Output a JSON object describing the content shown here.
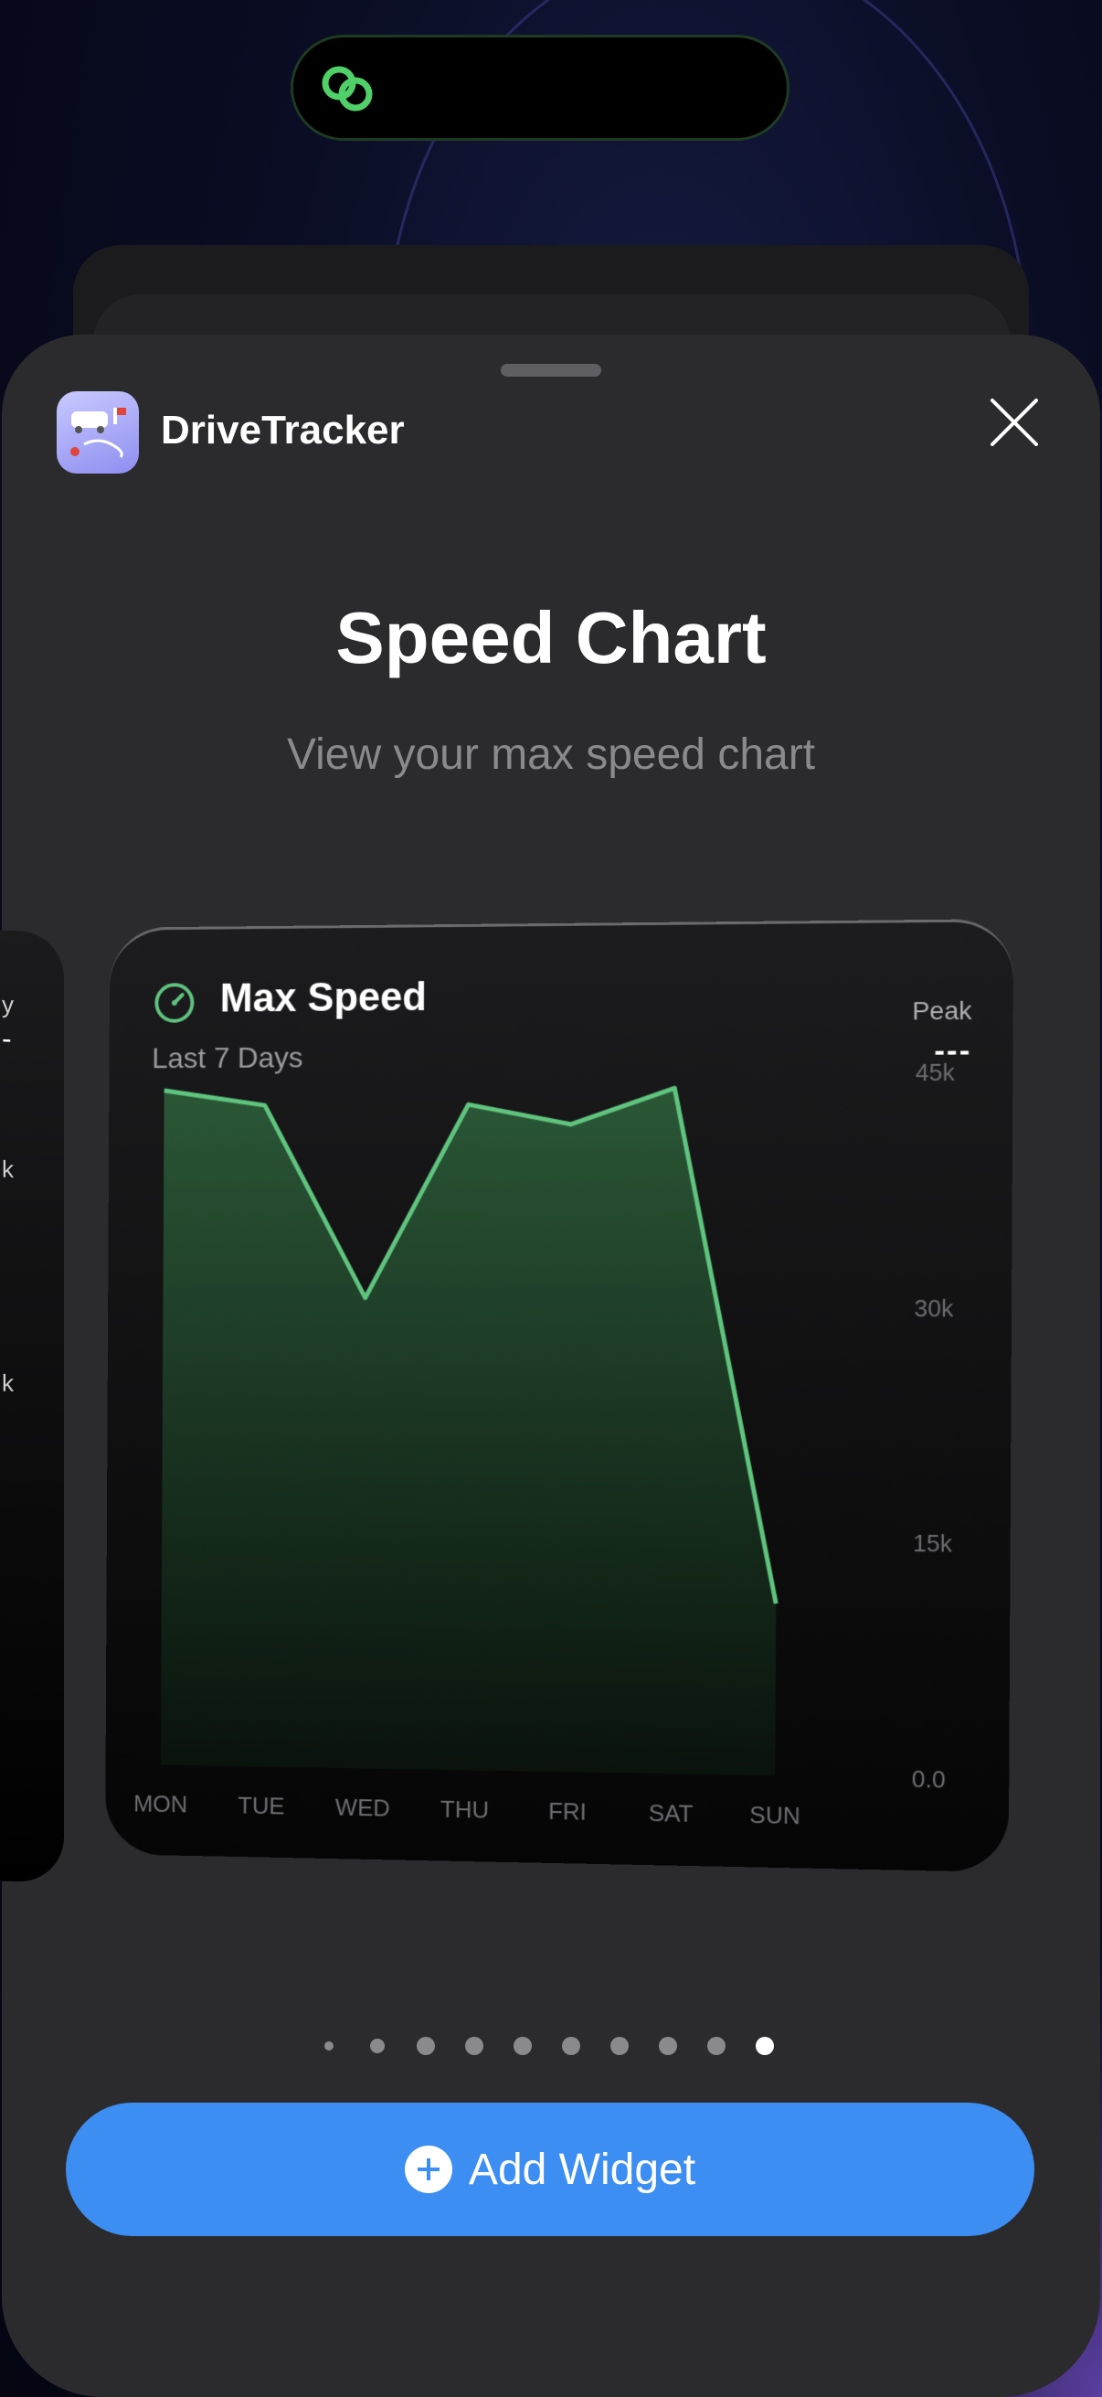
{
  "app": {
    "name": "DriveTracker"
  },
  "sheet": {
    "title": "Speed Chart",
    "subtitle": "View your max speed chart",
    "close_icon": "close-icon"
  },
  "side_widget": {
    "peak_char": "y",
    "dash": "-",
    "k1": "k",
    "k2": "k"
  },
  "widget": {
    "title": "Max Speed",
    "subtitle": "Last 7 Days",
    "peak_label": "Peak",
    "peak_value": "---",
    "icon": "speedometer-icon"
  },
  "chart_data": {
    "type": "area",
    "categories": [
      "MON",
      "TUE",
      "WED",
      "THU",
      "FRI",
      "SAT",
      "SUN"
    ],
    "series": [
      {
        "values": [
          44000,
          43000,
          30500,
          43000,
          41700,
          44000,
          11000
        ]
      }
    ],
    "y_ticks": [
      "0.0",
      "15k",
      "30k",
      "45k"
    ],
    "ylim": [
      0,
      48000
    ],
    "grid": false,
    "colors": {
      "line": "#5fc47e",
      "fill_top": "#2b5a38"
    }
  },
  "page_indicator": {
    "count": 10,
    "active_index": 9
  },
  "add_button": {
    "label": "Add Widget"
  },
  "colors": {
    "accent": "#3d8ef2",
    "sheet_bg": "#2b2b2d",
    "chart_green": "#5fc47e"
  }
}
